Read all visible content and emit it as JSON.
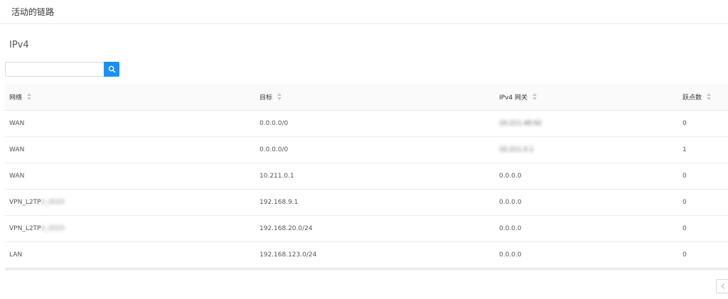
{
  "header": {
    "title": "活动的链路"
  },
  "section": {
    "title": "IPv4"
  },
  "search": {
    "placeholder": "",
    "value": ""
  },
  "table": {
    "columns": [
      "网络",
      "目标",
      "IPv4 网关",
      "跃点数"
    ],
    "rows": [
      {
        "network": "WAN",
        "network_suffix": "",
        "target": "0.0.0.0/0",
        "gateway": "10.211.48.92",
        "gateway_blurred": true,
        "metric": "0"
      },
      {
        "network": "WAN",
        "network_suffix": "",
        "target": "0.0.0.0/0",
        "gateway": "10.211.0.1",
        "gateway_blurred": true,
        "metric": "1"
      },
      {
        "network": "WAN",
        "network_suffix": "",
        "target": "10.211.0.1",
        "gateway": "0.0.0.0",
        "gateway_blurred": false,
        "metric": "0"
      },
      {
        "network": "VPN_L2TP",
        "network_suffix": "0_0029",
        "target": "192.168.9.1",
        "gateway": "0.0.0.0",
        "gateway_blurred": false,
        "metric": "0"
      },
      {
        "network": "VPN_L2TP",
        "network_suffix": "0_0029",
        "target": "192.168.20.0/24",
        "gateway": "0.0.0.0",
        "gateway_blurred": false,
        "metric": "0"
      },
      {
        "network": "LAN",
        "network_suffix": "",
        "target": "192.168.123.0/24",
        "gateway": "0.0.0.0",
        "gateway_blurred": false,
        "metric": "0"
      }
    ]
  },
  "icons": {
    "search": "search-icon",
    "sort": "sort-icon",
    "prev": "chevron-left-icon"
  },
  "colors": {
    "accent": "#1890ff",
    "header_bg": "#fafafa",
    "border": "#ececec"
  }
}
